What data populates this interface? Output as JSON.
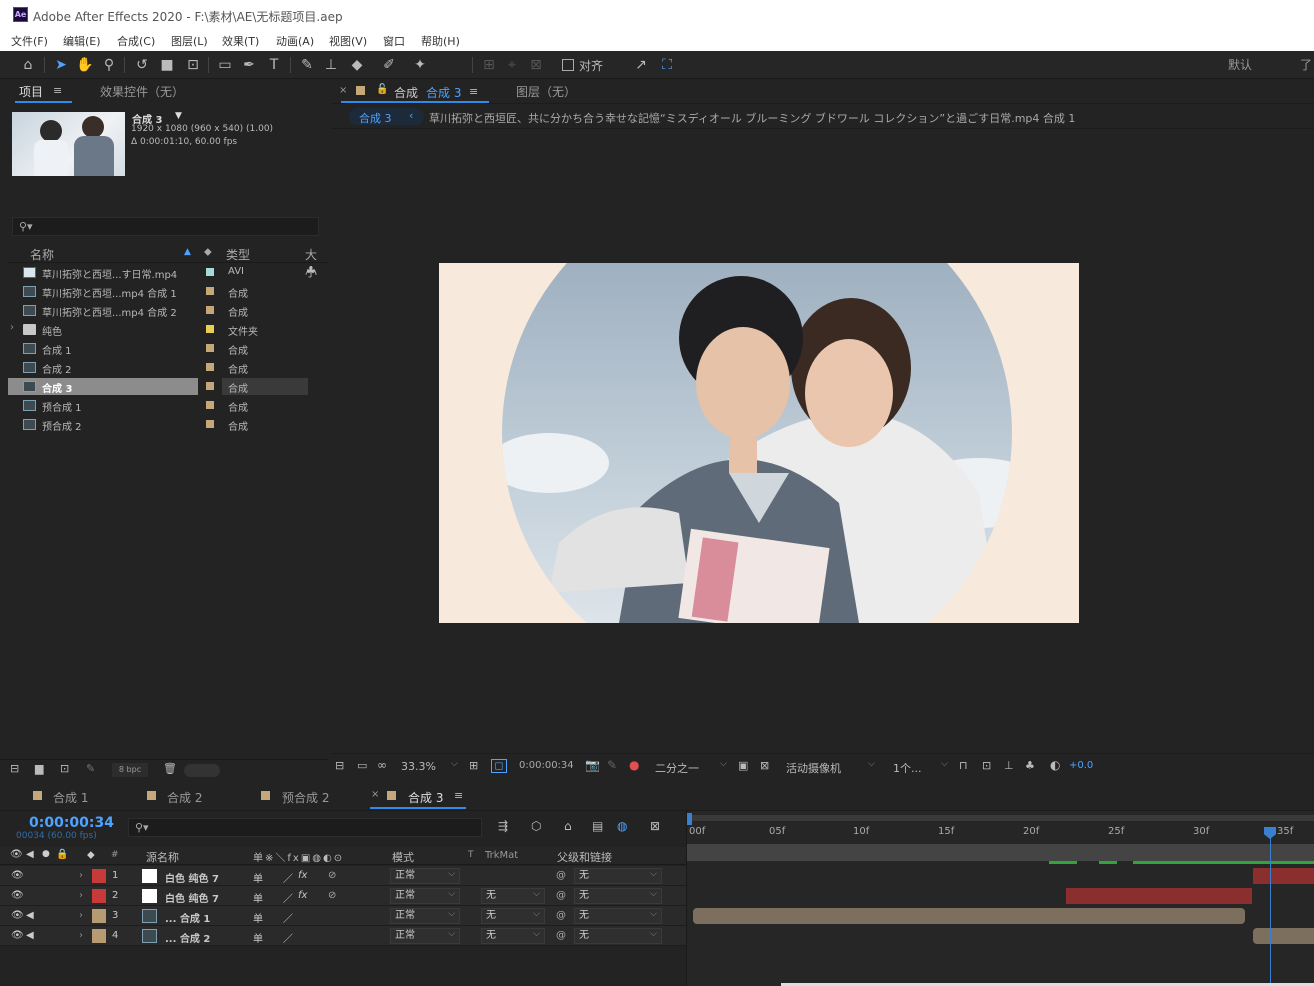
{
  "titlebar": {
    "app_logo": "Ae",
    "title": "Adobe After Effects 2020 - F:\\素材\\AE\\无标题项目.aep"
  },
  "menu": [
    "文件(F)",
    "编辑(E)",
    "合成(C)",
    "图层(L)",
    "效果(T)",
    "动画(A)",
    "视图(V)",
    "窗口",
    "帮助(H)"
  ],
  "toolbar": {
    "snap_label": "对齐",
    "workspace": "默认",
    "workspace_more": "了"
  },
  "project": {
    "tab_project": "项目",
    "tab_effects": "效果控件（无）",
    "selected_name": "合成 3",
    "selected_meta1": "1920 x 1080  (960 x 540) (1.00)",
    "selected_meta2": "Δ 0:00:01:10, 60.00 fps",
    "search_placeholder": "",
    "col_name": "名称",
    "col_type": "类型",
    "col_size": "大小",
    "items": [
      {
        "name": "草川拓弥と西垣...す日常.mp4",
        "type": "AVI",
        "icon": "video-file-icon",
        "color": "#a8d8d8"
      },
      {
        "name": "草川拓弥と西垣...mp4 合成 1",
        "type": "合成",
        "icon": "composition-icon",
        "color": "#c6a77a"
      },
      {
        "name": "草川拓弥と西垣...mp4 合成 2",
        "type": "合成",
        "icon": "composition-icon",
        "color": "#c6a77a"
      },
      {
        "name": "纯色",
        "type": "文件夹",
        "icon": "folder-icon",
        "color": "#e6cf52"
      },
      {
        "name": "合成 1",
        "type": "合成",
        "icon": "composition-icon",
        "color": "#c6a77a"
      },
      {
        "name": "合成 2",
        "type": "合成",
        "icon": "composition-icon",
        "color": "#c6a77a"
      },
      {
        "name": "合成 3",
        "type": "合成",
        "icon": "composition-icon",
        "color": "#c6a77a"
      },
      {
        "name": "预合成 1",
        "type": "合成",
        "icon": "composition-icon",
        "color": "#c6a77a"
      },
      {
        "name": "预合成 2",
        "type": "合成",
        "icon": "composition-icon",
        "color": "#c6a77a"
      }
    ],
    "bpc": "8 bpc"
  },
  "viewer": {
    "tab_comp_label": "合成",
    "tab_comp_name": "合成 3",
    "tab_layer": "图层（无）",
    "breadcrumb_current": "合成 3",
    "breadcrumb_path": "草川拓弥と西垣匠、共に分かち合う幸せな記憶“ミスディオール ブルーミング ブドワール コレクション”と過ごす日常.mp4 合成 1",
    "zoom": "33.3%",
    "timecode": "0:00:00:34",
    "resolution": "二分之一",
    "camera": "活动摄像机",
    "views": "1个...",
    "exposure": "+0.0"
  },
  "timeline": {
    "tabs": [
      "合成 1",
      "合成 2",
      "预合成 2",
      "合成 3"
    ],
    "current_time": "0:00:00:34",
    "current_frames": "00034 (60.00 fps)",
    "col_source": "源名称",
    "col_mode": "模式",
    "col_t": "T",
    "col_trkmat": "TrkMat",
    "col_parent": "父级和链接",
    "ruler": [
      "00f",
      "05f",
      "10f",
      "15f",
      "20f",
      "25f",
      "30f",
      "35f"
    ],
    "layers": [
      {
        "num": "1",
        "name": "白色 纯色 7",
        "label": "#c73a3a",
        "mode": "正常",
        "trkmat": "",
        "parent": "无",
        "thumb": "solid"
      },
      {
        "num": "2",
        "name": "白色 纯色 7",
        "label": "#c73a3a",
        "mode": "正常",
        "trkmat": "无",
        "parent": "无",
        "thumb": "solid"
      },
      {
        "num": "3",
        "name": "... 合成 1",
        "label": "#b59a72",
        "mode": "正常",
        "trkmat": "无",
        "parent": "无",
        "thumb": "comp"
      },
      {
        "num": "4",
        "name": "... 合成 2",
        "label": "#b59a72",
        "mode": "正常",
        "trkmat": "无",
        "parent": "无",
        "thumb": "comp"
      }
    ]
  }
}
